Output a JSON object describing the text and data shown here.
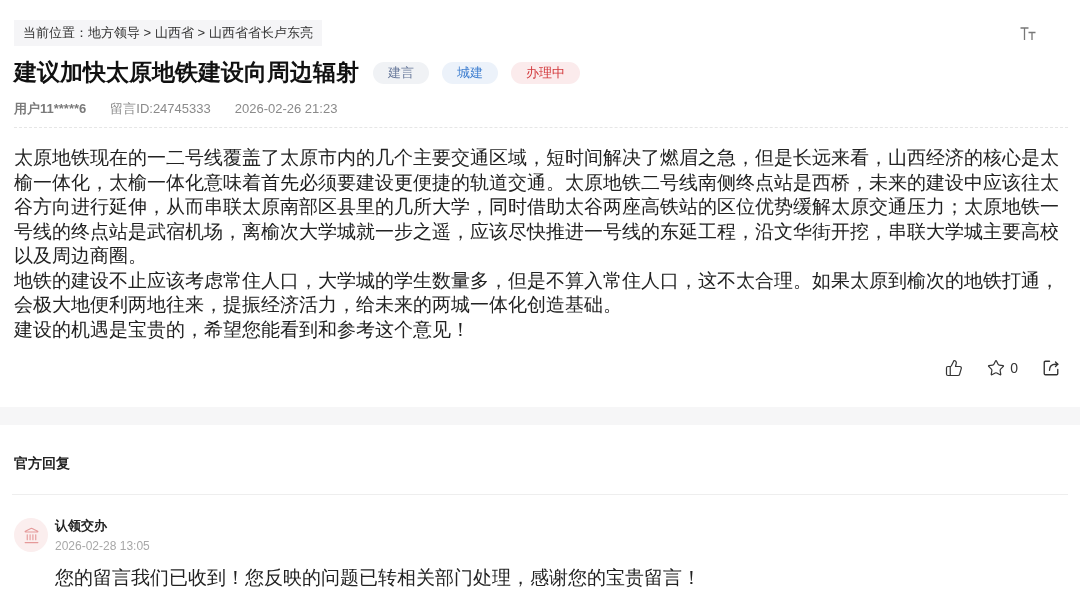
{
  "breadcrumb": "当前位置：地方领导 > 山西省 > 山西省省长卢东亮",
  "post": {
    "title": "建议加快太原地铁建设向周边辐射",
    "tags": [
      {
        "label": "建言",
        "color": "#67789a"
      },
      {
        "label": "城建",
        "color": "#3f7fd0"
      },
      {
        "label": "办理中",
        "color": "#d2393c"
      }
    ],
    "user": "用户11*****6",
    "message_id": "留言ID:24745333",
    "time": "2026-02-26 21:23",
    "paragraphs": [
      "太原地铁现在的一二号线覆盖了太原市内的几个主要交通区域，短时间解决了燃眉之急，但是长远来看，山西经济的核心是太榆一体化，太榆一体化意味着首先必须要建设更便捷的轨道交通。太原地铁二号线南侧终点站是西桥，未来的建设中应该往太谷方向进行延伸，从而串联太原南部区县里的几所大学，同时借助太谷两座高铁站的区位优势缓解太原交通压力；太原地铁一号线的终点站是武宿机场，离榆次大学城就一步之遥，应该尽快推进一号线的东延工程，沿文华街开挖，串联大学城主要高校以及周边商圈。",
      "地铁的建设不止应该考虑常住人口，大学城的学生数量多，但是不算入常住人口，这不太合理。如果太原到榆次的地铁打通，会极大地便利两地往来，提振经济活力，给未来的两城一体化创造基础。",
      "建设的机遇是宝贵的，希望您能看到和参考这个意见！"
    ],
    "favorite_count": "0"
  },
  "official_reply": {
    "title": "官方回复",
    "replies": [
      {
        "author": "认领交办",
        "time": "2026-02-28 13:05",
        "text": "您的留言我们已收到！您反映的问题已转相关部门处理，感谢您的宝贵留言！"
      }
    ]
  }
}
